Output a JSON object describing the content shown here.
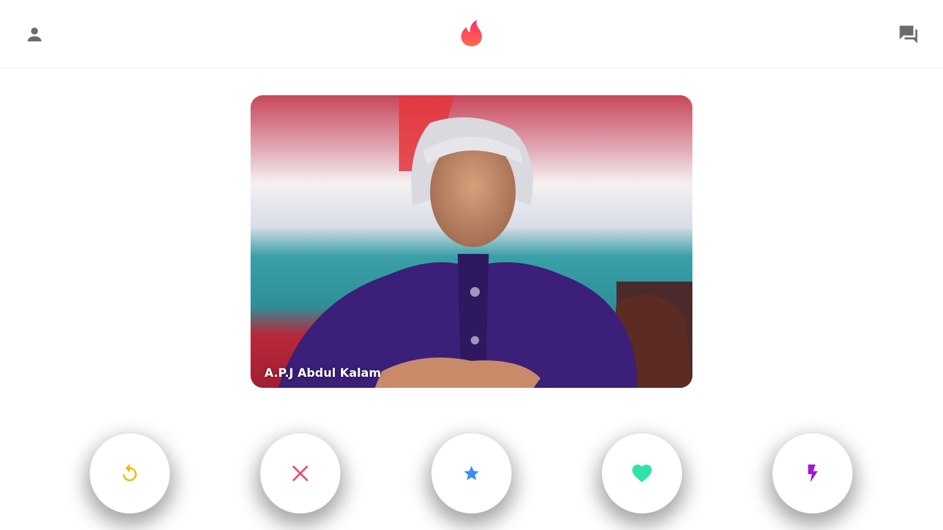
{
  "header": {
    "profile_icon": "person-icon",
    "logo_icon": "flame-logo-icon",
    "chat_icon": "forum-icon",
    "colors": {
      "icon_gray": "#6b6b6b",
      "logo_red": "#fd3a5c",
      "logo_orange": "#ff6a4d"
    }
  },
  "card": {
    "name": "A.P.J Abdul Kalam"
  },
  "actions": [
    {
      "name": "rewind",
      "icon": "replay-icon",
      "color": "#f5b800"
    },
    {
      "name": "nope",
      "icon": "close-icon",
      "color": "#ec4b6a"
    },
    {
      "name": "super-like",
      "icon": "star-icon",
      "color": "#3b8ef2"
    },
    {
      "name": "like",
      "icon": "heart-icon",
      "color": "#2fe3a8"
    },
    {
      "name": "boost",
      "icon": "flash-icon",
      "color": "#9a18d6"
    }
  ]
}
